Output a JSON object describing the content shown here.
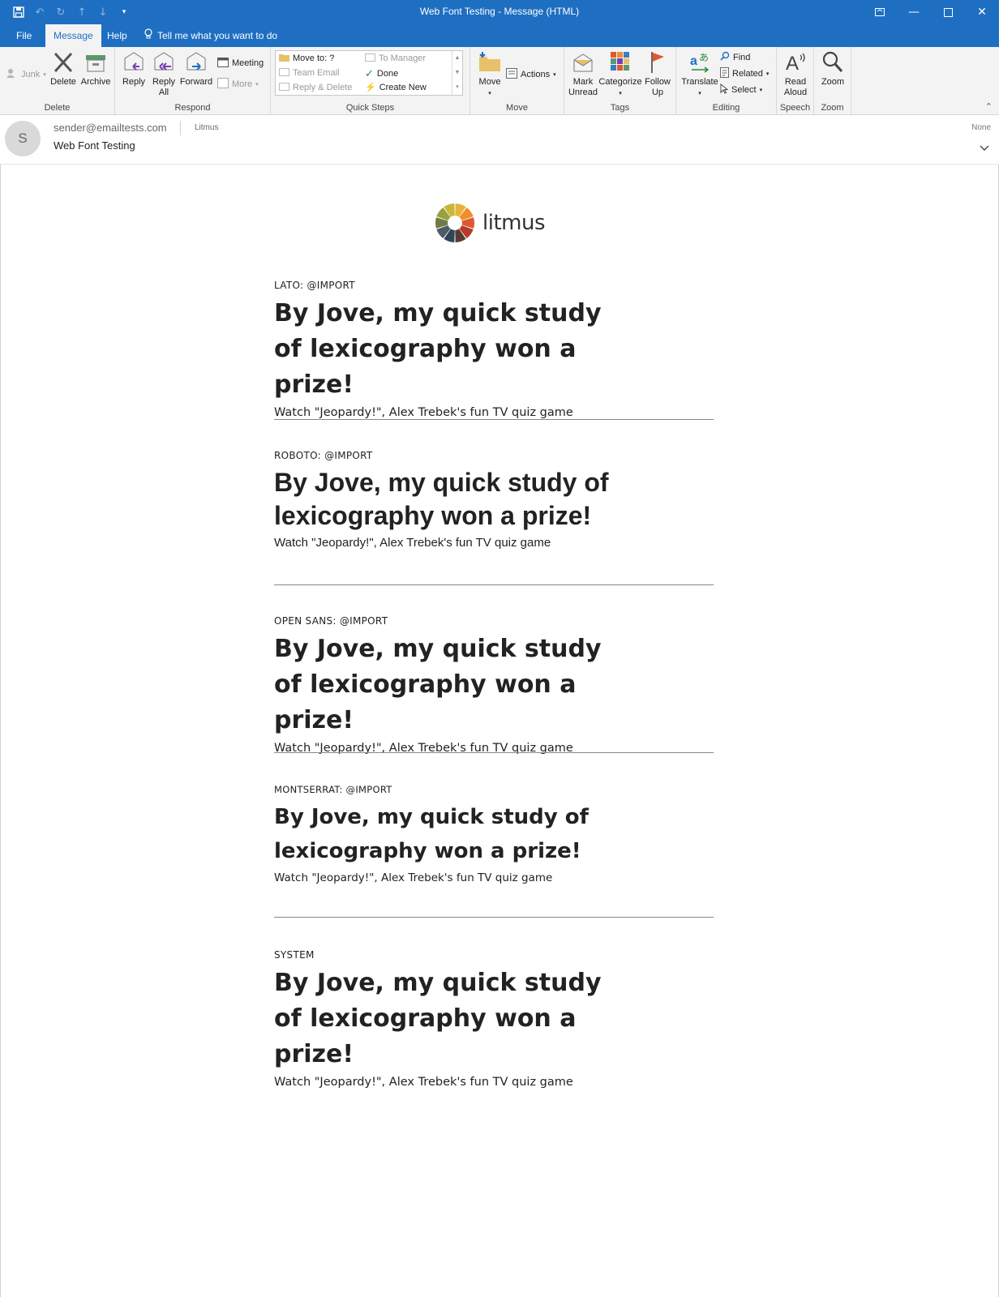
{
  "window": {
    "title": "Web Font Testing  -  Message (HTML)"
  },
  "tabs": [
    "File",
    "Message",
    "Help"
  ],
  "tell_me": "Tell me what you want to do",
  "ribbon": {
    "delete_group": {
      "label": "Delete",
      "junk": "Junk",
      "delete": "Delete",
      "archive": "Archive"
    },
    "respond_group": {
      "label": "Respond",
      "reply": "Reply",
      "reply_all_1": "Reply",
      "reply_all_2": "All",
      "forward": "Forward",
      "meeting": "Meeting",
      "more": "More"
    },
    "quick_steps_group": {
      "label": "Quick Steps",
      "move_to": "Move to: ?",
      "team_email": "Team Email",
      "reply_delete": "Reply & Delete",
      "to_manager": "To Manager",
      "done": "Done",
      "create_new": "Create New"
    },
    "move_group": {
      "label": "Move",
      "move": "Move",
      "actions": "Actions"
    },
    "tags_group": {
      "label": "Tags",
      "mark_unread_1": "Mark",
      "mark_unread_2": "Unread",
      "categorize": "Categorize",
      "follow_up_1": "Follow",
      "follow_up_2": "Up"
    },
    "editing_group": {
      "label": "Editing",
      "translate": "Translate",
      "find": "Find",
      "related": "Related",
      "select": "Select"
    },
    "speech_group": {
      "label": "Speech",
      "read_aloud_1": "Read",
      "read_aloud_2": "Aloud"
    },
    "zoom_group": {
      "label": "Zoom",
      "zoom": "Zoom"
    }
  },
  "header": {
    "avatar_initial": "S",
    "sender": "sender@emailtests.com",
    "recipient": "Litmus",
    "subject": "Web Font Testing",
    "category": "None"
  },
  "body": {
    "logo_text": "litmus",
    "samples": [
      {
        "label": "LATO: @IMPORT",
        "heading": "By Jove, my quick study of lexicography won a prize!",
        "sub": "Watch \"Jeopardy!\", Alex Trebek's fun TV quiz game"
      },
      {
        "label": "ROBOTO: @IMPORT",
        "heading": "By Jove, my quick study of lexicography won a prize!",
        "sub": "Watch \"Jeopardy!\", Alex Trebek's fun TV quiz game"
      },
      {
        "label": "OPEN SANS: @IMPORT",
        "heading": "By Jove, my quick study of lexicography won a prize!",
        "sub": "Watch \"Jeopardy!\", Alex Trebek's fun TV quiz game"
      },
      {
        "label": "MONTSERRAT: @IMPORT",
        "heading": "By Jove, my quick study of lexicography won a prize!",
        "sub": "Watch \"Jeopardy!\", Alex Trebek's fun TV quiz game"
      },
      {
        "label": "SYSTEM",
        "heading": "By Jove, my quick study of lexicography won a prize!",
        "sub": "Watch \"Jeopardy!\", Alex Trebek's fun TV quiz game"
      }
    ]
  },
  "colors": {
    "titlebar": "#1e6fc2",
    "ribbon_bg": "#f3f3f3",
    "logo_wheel": [
      "#e8b33a",
      "#f08d2c",
      "#e0582f",
      "#b63b2b",
      "#5a3b34",
      "#2e4558",
      "#4c5b65",
      "#6f7a49",
      "#96a23b",
      "#c9b53a"
    ]
  }
}
